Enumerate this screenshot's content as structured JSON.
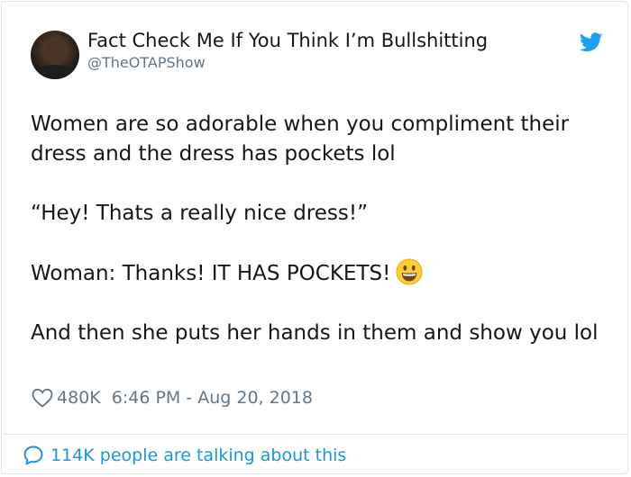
{
  "tweet": {
    "author_name": "Fact Check Me If You Think I’m Bullshitting",
    "author_handle": "@TheOTAPShow",
    "text_lines": [
      "Women are so adorable when you compliment their dress and the dress has pockets lol",
      "“Hey! Thats a really nice dress!”",
      "Woman: Thanks! IT HAS POCKETS!",
      "And then she puts her hands in them and show you lol"
    ],
    "emoji": "smiling-face-with-open-mouth",
    "likes": "480K",
    "timestamp": "6:46 PM - Aug 20, 2018",
    "conversation_label": "114K people are talking about this"
  },
  "icons": {
    "bird": "twitter-bird-icon",
    "heart": "heart-outline-icon",
    "bubble": "speech-bubble-icon"
  },
  "colors": {
    "twitter_blue": "#1da1f2",
    "link_blue": "#1b95e0",
    "secondary_text": "#657786",
    "border": "#e1e8ed"
  }
}
